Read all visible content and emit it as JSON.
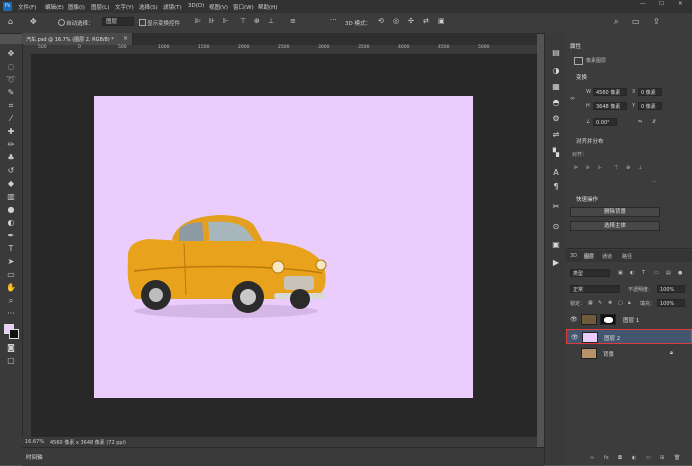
{
  "menu": {
    "items": [
      "文件(F)",
      "编辑(E)",
      "图像(I)",
      "图层(L)",
      "文字(Y)",
      "选择(S)",
      "滤镜(T)",
      "3D(D)",
      "视图(V)",
      "窗口(W)",
      "帮助(H)"
    ]
  },
  "options": {
    "auto_select_label": "自动选择：",
    "auto_select_value": "图层",
    "show_transform_label": "显示变换控件",
    "mode_3d_label": "3D 模式："
  },
  "document": {
    "tab_title": "汽车.psd @ 16.7% (图层 2, RGB/8) *"
  },
  "ruler": {
    "ticks": [
      "500",
      "0",
      "500",
      "1000",
      "1500",
      "2000",
      "2500",
      "3000",
      "3500",
      "4000",
      "4500",
      "5000"
    ]
  },
  "status": {
    "zoom": "16.67%",
    "doc_info": "4560 像素 x 3648 像素 (72 ppi)"
  },
  "timeline": {
    "label": "时间轴"
  },
  "properties": {
    "tab": "属性",
    "context": "像素图层",
    "transform_title": "变换",
    "w_label": "W",
    "w_value": "4560 像素",
    "h_label": "H",
    "h_value": "3648 像素",
    "x_label": "X",
    "x_value": "0 像素",
    "y_label": "Y",
    "y_value": "0 像素",
    "angle_value": "0.00°",
    "align_title": "对齐并分布",
    "align_label": "对齐：",
    "quick_title": "快速操作",
    "remove_bg": "删除背景",
    "select_subject": "选择主体"
  },
  "layers_panel": {
    "tabs": [
      "3D",
      "图层",
      "通道",
      "路径"
    ],
    "kind_filter": "类型",
    "blend_mode": "正常",
    "opacity_label": "不透明度：",
    "opacity_value": "100%",
    "lock_label": "锁定：",
    "fill_label": "填充：",
    "fill_value": "100%",
    "layers": [
      {
        "name": "图层 1",
        "selected": false,
        "thumb": "car"
      },
      {
        "name": "图层 2",
        "selected": true,
        "thumb": "lilac"
      },
      {
        "name": "背景",
        "selected": false,
        "thumb": "photo"
      }
    ]
  },
  "colors": {
    "artboard": "#eacdfc",
    "selection_highlight": "#e03a3a",
    "car_body": "#e8a21c"
  }
}
